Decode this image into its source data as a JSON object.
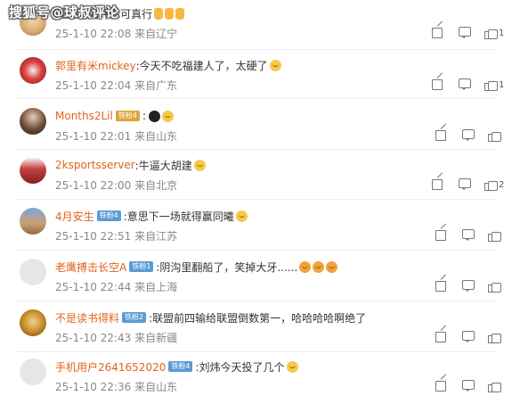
{
  "watermark": "搜狐号@球叔评论",
  "comments": [
    {
      "name": "",
      "badge": "铁粉3",
      "text": ":刘炜你可真行",
      "time": "25-1-10 22:08",
      "loc": "来自辽宁",
      "likes": "1"
    },
    {
      "name": "郭里有米mickey",
      "badge": "",
      "text": ":今天不吃福建人了，太硬了",
      "time": "25-1-10 22:04",
      "loc": "来自广东",
      "likes": "1"
    },
    {
      "name": "Months2Lil",
      "badge": "铁粉4",
      "text": "",
      "time": "25-1-10 22:01",
      "loc": "来自山东",
      "likes": ""
    },
    {
      "name": "2ksportsserver",
      "badge": "",
      "text": ":牛逼大胡建",
      "time": "25-1-10 22:00",
      "loc": "来自北京",
      "likes": "2"
    },
    {
      "name": "4月安生",
      "badge": "铁粉4",
      "text": ":意思下一场就得赢同曦",
      "time": "25-1-10 22:51",
      "loc": "来自江苏",
      "likes": ""
    },
    {
      "name": "老鹰搏击长空A",
      "badge": "铁粉1",
      "text": ":阴沟里翻船了，笑掉大牙......",
      "time": "25-1-10 22:44",
      "loc": "来自上海",
      "likes": ""
    },
    {
      "name": "不是读书得料",
      "badge": "铁粉2",
      "text": ":联盟前四输给联盟倒数第一，哈哈哈哈啊绝了",
      "time": "25-1-10 22:43",
      "loc": "来自新疆",
      "likes": ""
    },
    {
      "name": "手机用户2641652020",
      "badge": "铁粉4",
      "text": ":刘炜今天投了几个",
      "time": "25-1-10 22:36",
      "loc": "来自山东",
      "likes": ""
    }
  ]
}
